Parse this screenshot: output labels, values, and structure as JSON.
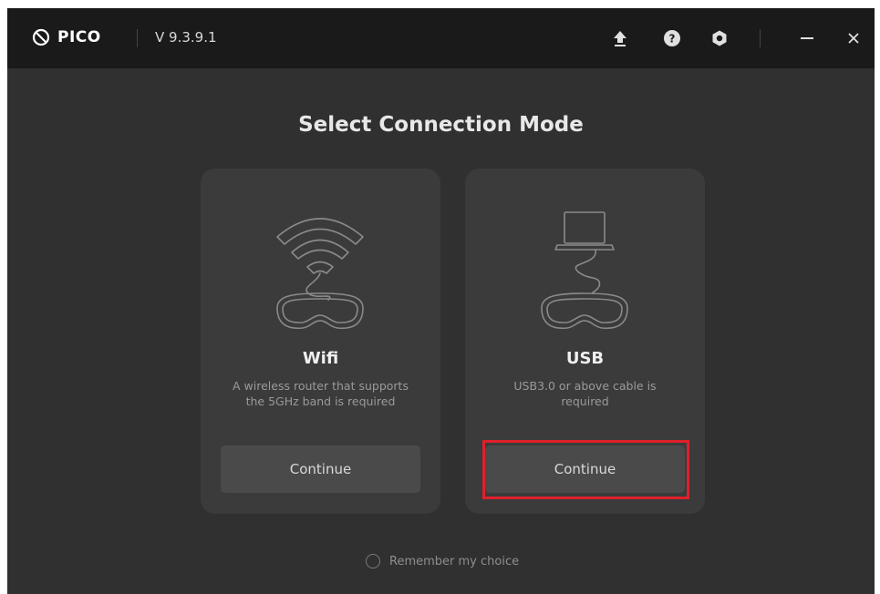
{
  "titlebar": {
    "app_name": "PICO",
    "version": "V 9.3.9.1",
    "icons": [
      "upload-icon",
      "help-icon",
      "settings-icon",
      "minimize-icon",
      "close-icon"
    ]
  },
  "main": {
    "title": "Select Connection Mode",
    "cards": [
      {
        "id": "wifi",
        "title": "Wifi",
        "description": "A wireless router that supports the 5GHz band is required",
        "button_label": "Continue"
      },
      {
        "id": "usb",
        "title": "USB",
        "description": "USB3.0 or above cable is required",
        "button_label": "Continue"
      }
    ],
    "remember_label": "Remember my choice",
    "remember_checked": false
  },
  "colors": {
    "titlebar_bg": "#1a1a1a",
    "window_bg": "#303030",
    "card_bg": "#3b3b3b",
    "button_bg": "#4a4a4a",
    "highlight": "#e0202a"
  }
}
